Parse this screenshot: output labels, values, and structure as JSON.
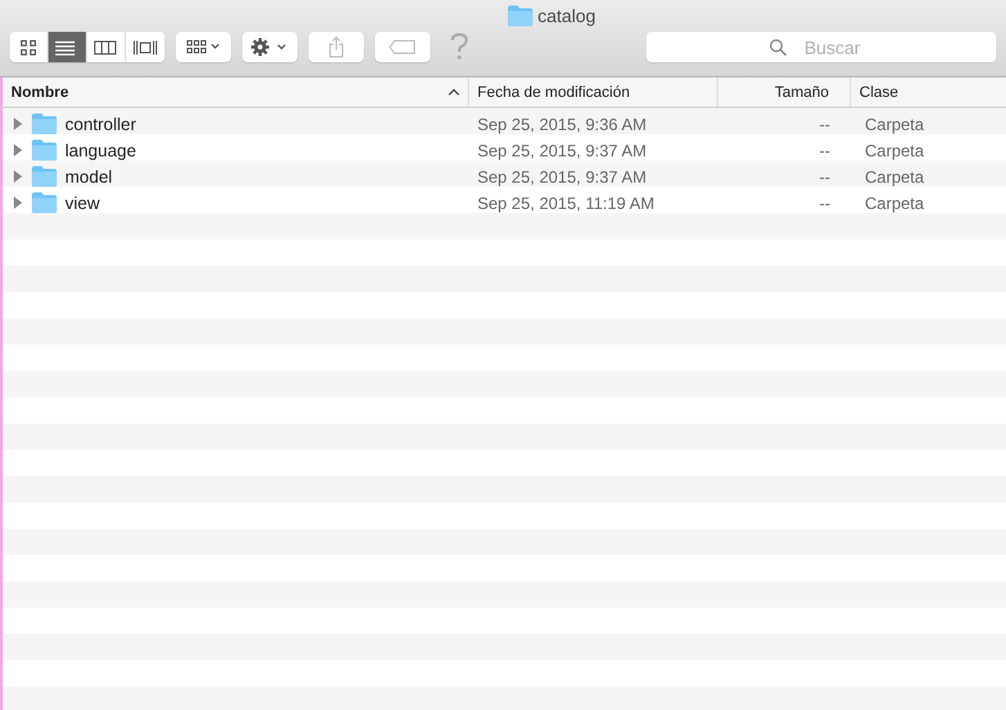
{
  "window": {
    "title": "catalog"
  },
  "toolbar": {
    "view_modes": [
      {
        "kind": "icons",
        "selected": false
      },
      {
        "kind": "list",
        "selected": true
      },
      {
        "kind": "columns",
        "selected": false
      },
      {
        "kind": "coverflow",
        "selected": false
      }
    ],
    "search": {
      "placeholder": "Buscar"
    }
  },
  "table": {
    "columns": [
      {
        "label": "Nombre",
        "sorted": true
      },
      {
        "label": "Fecha de modificación",
        "sorted": false
      },
      {
        "label": "Tamaño",
        "sorted": false
      },
      {
        "label": "Clase",
        "sorted": false
      }
    ],
    "rows": [
      {
        "name": "controller",
        "modified": "Sep 25, 2015, 9:36 AM",
        "size": "--",
        "kind": "Carpeta",
        "expanded": false
      },
      {
        "name": "language",
        "modified": "Sep 25, 2015, 9:37 AM",
        "size": "--",
        "kind": "Carpeta",
        "expanded": false
      },
      {
        "name": "model",
        "modified": "Sep 25, 2015, 9:37 AM",
        "size": "--",
        "kind": "Carpeta",
        "expanded": false
      },
      {
        "name": "view",
        "modified": "Sep 25, 2015, 11:19 AM",
        "size": "--",
        "kind": "Carpeta",
        "expanded": false
      }
    ]
  }
}
